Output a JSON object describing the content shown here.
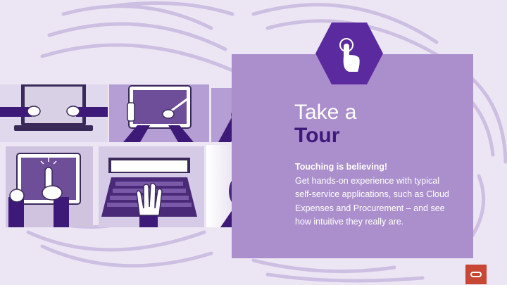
{
  "slide": {
    "title_line1": "Take a",
    "title_line2": "Tour",
    "lead": "Touching is believing!",
    "body": "Get hands-on experience with typical self-service applications, such as Cloud Expenses and Procurement – and see how intuitive they really are."
  },
  "icons": {
    "hex_badge": "touch-hand-icon",
    "logo": "oracle-logo-icon",
    "tiles": [
      "laptop-hands-icon",
      "tablet-stylus-icon",
      "smartphone-hand-icon",
      "tablet-finger-icon",
      "laptop-keyboard-hand-icon",
      "mouse-hand-icon"
    ]
  },
  "colors": {
    "background": "#ece6f4",
    "panel": "#ab8fcc",
    "hexagon": "#5a2a9e",
    "title_accent": "#3e1a78",
    "logo_red": "#c74634",
    "tile_light": "#d6cbe6",
    "tile_dark": "#4a2a78"
  }
}
